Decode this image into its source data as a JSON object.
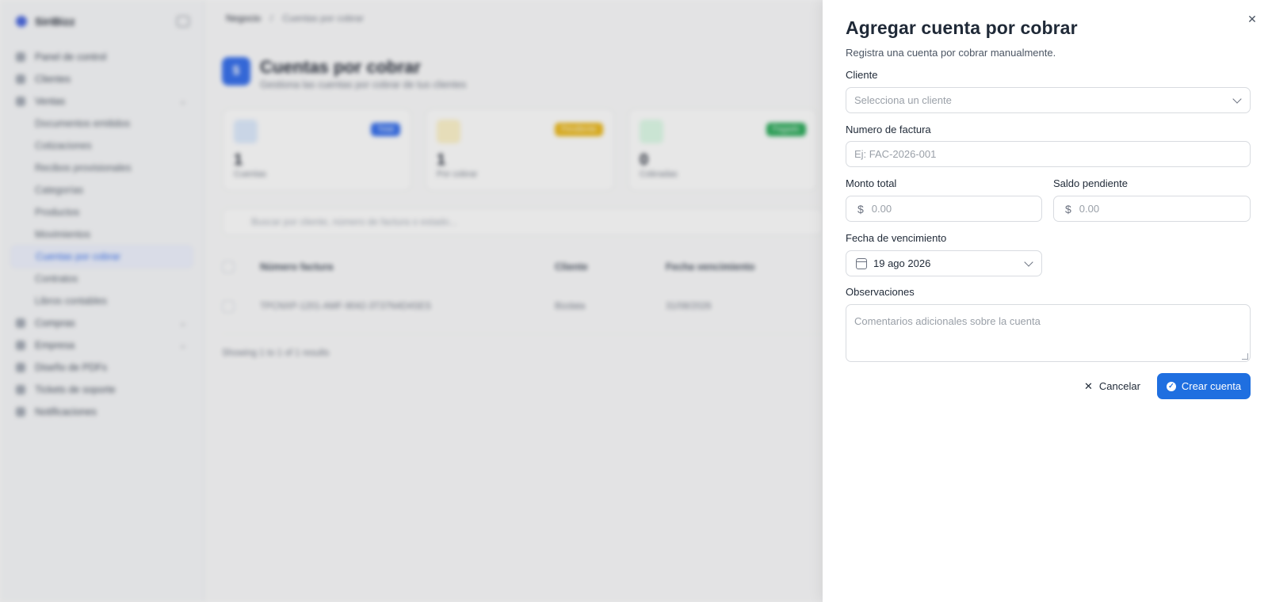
{
  "sidebar": {
    "brand": "SiriBizz",
    "items": [
      {
        "label": "Panel de control"
      },
      {
        "label": "Clientes"
      },
      {
        "label": "Ventas"
      }
    ],
    "sub_items": [
      {
        "label": "Documentos emitidos"
      },
      {
        "label": "Cotizaciones"
      },
      {
        "label": "Recibos provisionales"
      },
      {
        "label": "Categorías"
      },
      {
        "label": "Productos"
      },
      {
        "label": "Movimientos"
      },
      {
        "label": "Cuentas por cobrar"
      },
      {
        "label": "Contratos"
      },
      {
        "label": "Libros contables"
      }
    ],
    "bottom_items": [
      {
        "label": "Compras"
      },
      {
        "label": "Empresa"
      },
      {
        "label": "Diseño de PDFs"
      },
      {
        "label": "Tickets de soporte"
      },
      {
        "label": "Notificaciones"
      }
    ]
  },
  "main": {
    "breadcrumb": [
      "Negocio",
      "Cuentas por cobrar"
    ],
    "title": "Cuentas por cobrar",
    "subtitle": "Gestiona las cuentas por cobrar de tus clientes",
    "stats": [
      {
        "value": "1",
        "label": "Cuentas",
        "badge": "Total",
        "color": "#2563eb",
        "tint": "#dbeafe"
      },
      {
        "value": "1",
        "label": "Por cobrar",
        "badge": "Pendiente",
        "color": "#eab308",
        "tint": "#fef3c7"
      },
      {
        "value": "0",
        "label": "Cobradas",
        "badge": "Pagado",
        "color": "#16a34a",
        "tint": "#dcfce7"
      }
    ],
    "search_placeholder": "Buscar por cliente, número de factura o estado...",
    "table_headers": [
      "Número factura",
      "Cliente",
      "Fecha vencimiento"
    ],
    "rows": [
      {
        "invoice": "TPCNXP-1201-AMF-9042-3T37N4D4SES",
        "client": "Bizdata",
        "due": "31/08/2026"
      }
    ],
    "results_text": "Showing 1 to 1 of 1 results"
  },
  "drawer": {
    "title": "Agregar cuenta por cobrar",
    "subtitle": "Registra una cuenta por cobrar manualmente.",
    "client": {
      "label": "Cliente",
      "placeholder": "Selecciona un cliente"
    },
    "invoice": {
      "label": "Numero de factura",
      "placeholder": "Ej: FAC-2026-001"
    },
    "total": {
      "label": "Monto total",
      "placeholder": "0.00",
      "prefix": "$"
    },
    "balance": {
      "label": "Saldo pendiente",
      "placeholder": "0.00",
      "prefix": "$"
    },
    "due_date": {
      "label": "Fecha de vencimiento",
      "value": "19 ago 2026"
    },
    "notes": {
      "label": "Observaciones",
      "placeholder": "Comentarios adicionales sobre la cuenta"
    },
    "cancel_label": "Cancelar",
    "create_label": "Crear cuenta",
    "accent": "#1f6fe0"
  }
}
